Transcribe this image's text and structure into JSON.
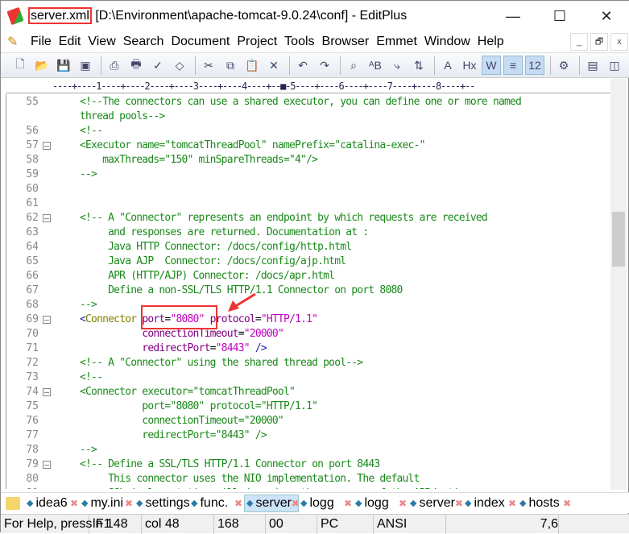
{
  "window": {
    "file": "server.xml",
    "path": " [D:\\Environment\\apache-tomcat-9.0.24\\conf] - EditPlus",
    "minimize": "—",
    "maximize": "☐",
    "close": "✕"
  },
  "menu": [
    "File",
    "Edit",
    "View",
    "Search",
    "Document",
    "Project",
    "Tools",
    "Browser",
    "Emmet",
    "Window",
    "Help"
  ],
  "mdi": [
    "_",
    "🗗",
    "x"
  ],
  "toolbar_icons": [
    "new-file",
    "open",
    "save",
    "save-all",
    "print-preview",
    "print",
    "spellcheck",
    "browser-preview",
    "cut",
    "copy",
    "paste",
    "delete",
    "undo",
    "redo",
    "find",
    "replace",
    "goto",
    "sort",
    "font",
    "hex",
    "word-wrap",
    "indent",
    "line-numbers",
    "settings",
    "panel",
    "split"
  ],
  "ruler": "----+----1----+----2----+----3----+----4----+--■-5----+----6----+----7----+----8----+--",
  "lines": [
    {
      "n": "55",
      "f": false,
      "s": [
        [
          "c",
          "<!--The connectors can use a shared executor, you can define one or more named"
        ]
      ]
    },
    {
      "n": "",
      "f": false,
      "s": [
        [
          "c",
          "thread pools-->"
        ]
      ]
    },
    {
      "n": "56",
      "f": false,
      "s": [
        [
          "c",
          "<!--"
        ]
      ]
    },
    {
      "n": "57",
      "f": true,
      "s": [
        [
          "c",
          "<Executor name=\"tomcatThreadPool\" namePrefix=\"catalina-exec-\""
        ]
      ]
    },
    {
      "n": "58",
      "f": false,
      "s": [
        [
          "c",
          "    maxThreads=\"150\" minSpareThreads=\"4\"/>"
        ]
      ]
    },
    {
      "n": "59",
      "f": false,
      "s": [
        [
          "c",
          "-->"
        ]
      ]
    },
    {
      "n": "60",
      "f": false,
      "s": []
    },
    {
      "n": "61",
      "f": false,
      "s": []
    },
    {
      "n": "62",
      "f": true,
      "s": [
        [
          "c",
          "<!-- A \"Connector\" represents an endpoint by which requests are received"
        ]
      ]
    },
    {
      "n": "63",
      "f": false,
      "s": [
        [
          "c",
          "     and responses are returned. Documentation at :"
        ]
      ]
    },
    {
      "n": "64",
      "f": false,
      "s": [
        [
          "c",
          "     Java HTTP Connector: /docs/config/http.html"
        ]
      ]
    },
    {
      "n": "65",
      "f": false,
      "s": [
        [
          "c",
          "     Java AJP  Connector: /docs/config/ajp.html"
        ]
      ]
    },
    {
      "n": "66",
      "f": false,
      "s": [
        [
          "c",
          "     APR (HTTP/AJP) Connector: /docs/apr.html"
        ]
      ]
    },
    {
      "n": "67",
      "f": false,
      "s": [
        [
          "c",
          "     Define a non-SSL/TLS HTTP/1.1 Connector on port 8080"
        ]
      ]
    },
    {
      "n": "68",
      "f": false,
      "s": [
        [
          "c",
          "-->"
        ]
      ]
    },
    {
      "n": "69",
      "f": true,
      "s": [
        [
          "t",
          "<"
        ],
        [
          "e",
          "Connector"
        ],
        [
          "p",
          " "
        ],
        [
          "a",
          "port"
        ],
        [
          "p",
          "="
        ],
        [
          "v",
          "\"8080\""
        ],
        [
          "p",
          " "
        ],
        [
          "a",
          "protocol"
        ],
        [
          "p",
          "="
        ],
        [
          "v",
          "\"HTTP/1.1\""
        ]
      ]
    },
    {
      "n": "70",
      "f": false,
      "s": [
        [
          "p",
          "           "
        ],
        [
          "a",
          "connectionTimeout"
        ],
        [
          "p",
          "="
        ],
        [
          "v",
          "\"20000\""
        ]
      ]
    },
    {
      "n": "71",
      "f": false,
      "s": [
        [
          "p",
          "           "
        ],
        [
          "a",
          "redirectPort"
        ],
        [
          "p",
          "="
        ],
        [
          "v",
          "\"8443\""
        ],
        [
          "p",
          " "
        ],
        [
          "t",
          "/>"
        ]
      ]
    },
    {
      "n": "72",
      "f": false,
      "s": [
        [
          "c",
          "<!-- A \"Connector\" using the shared thread pool-->"
        ]
      ]
    },
    {
      "n": "73",
      "f": false,
      "s": [
        [
          "c",
          "<!--"
        ]
      ]
    },
    {
      "n": "74",
      "f": true,
      "s": [
        [
          "c",
          "<Connector executor=\"tomcatThreadPool\""
        ]
      ]
    },
    {
      "n": "75",
      "f": false,
      "s": [
        [
          "c",
          "           port=\"8080\" protocol=\"HTTP/1.1\""
        ]
      ]
    },
    {
      "n": "76",
      "f": false,
      "s": [
        [
          "c",
          "           connectionTimeout=\"20000\""
        ]
      ]
    },
    {
      "n": "77",
      "f": false,
      "s": [
        [
          "c",
          "           redirectPort=\"8443\" />"
        ]
      ]
    },
    {
      "n": "78",
      "f": false,
      "s": [
        [
          "c",
          "-->"
        ]
      ]
    },
    {
      "n": "79",
      "f": true,
      "s": [
        [
          "c",
          "<!-- Define a SSL/TLS HTTP/1.1 Connector on port 8443"
        ]
      ]
    },
    {
      "n": "80",
      "f": false,
      "s": [
        [
          "c",
          "     This connector uses the NIO implementation. The default"
        ]
      ]
    },
    {
      "n": "81",
      "f": false,
      "s": [
        [
          "c",
          "     SSL implementation will depend on the presence of the APR/native"
        ]
      ]
    }
  ],
  "tabs": [
    {
      "label": "idea6",
      "active": false
    },
    {
      "label": "my.ini",
      "active": false
    },
    {
      "label": "settings",
      "active": false
    },
    {
      "label": "func.",
      "active": false
    },
    {
      "label": "server",
      "active": true
    },
    {
      "label": "logg",
      "active": false
    },
    {
      "label": "logg",
      "active": false
    },
    {
      "label": "server",
      "active": false
    },
    {
      "label": "index",
      "active": false
    },
    {
      "label": "hosts",
      "active": false
    }
  ],
  "status": [
    "For Help, press F1",
    "ln 148",
    "col 48",
    "168",
    "00",
    "PC",
    "ANSI",
    "7,6"
  ],
  "colors": {
    "highlight": "#e33333",
    "comment": "#1b8a1b",
    "attr": "#800080",
    "value": "#c000c0"
  }
}
